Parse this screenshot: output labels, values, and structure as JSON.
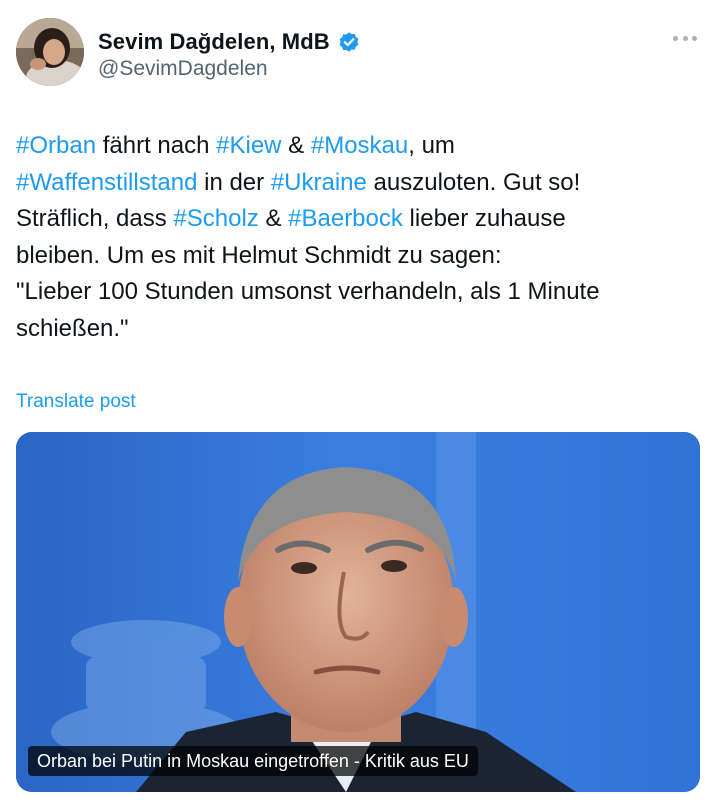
{
  "author": {
    "display_name": "Sevim Dağdelen, MdB",
    "handle": "@SevimDagdelen",
    "verified": true,
    "verified_color": "#1d9bf0"
  },
  "post": {
    "segments": [
      {
        "text": "#Orban",
        "hashtag": true
      },
      {
        "text": " fährt nach ",
        "hashtag": false
      },
      {
        "text": "#Kiew",
        "hashtag": true
      },
      {
        "text": " & ",
        "hashtag": false
      },
      {
        "text": "#Moskau",
        "hashtag": true
      },
      {
        "text": ", um\n",
        "hashtag": false
      },
      {
        "text": "#Waffenstillstand",
        "hashtag": true
      },
      {
        "text": " in der ",
        "hashtag": false
      },
      {
        "text": "#Ukraine",
        "hashtag": true
      },
      {
        "text": " auszuloten. Gut so!\nSträflich, dass ",
        "hashtag": false
      },
      {
        "text": "#Scholz",
        "hashtag": true
      },
      {
        "text": " & ",
        "hashtag": false
      },
      {
        "text": "#Baerbock",
        "hashtag": true
      },
      {
        "text": " lieber zuhause\nbleiben. Um es mit Helmut Schmidt zu sagen:\n\"Lieber 100 Stunden umsonst verhandeln, als 1 Minute\nschießen.\"",
        "hashtag": false
      }
    ],
    "translate_label": "Translate post",
    "hashtag_color": "#1d9bf0"
  },
  "media": {
    "caption": "Orban bei Putin in Moskau eingetroffen - Kritik aus EU",
    "background_color": "#2c6fd0"
  },
  "icons": {
    "more": "more-horizontal-icon",
    "verified": "verified-badge-icon"
  }
}
